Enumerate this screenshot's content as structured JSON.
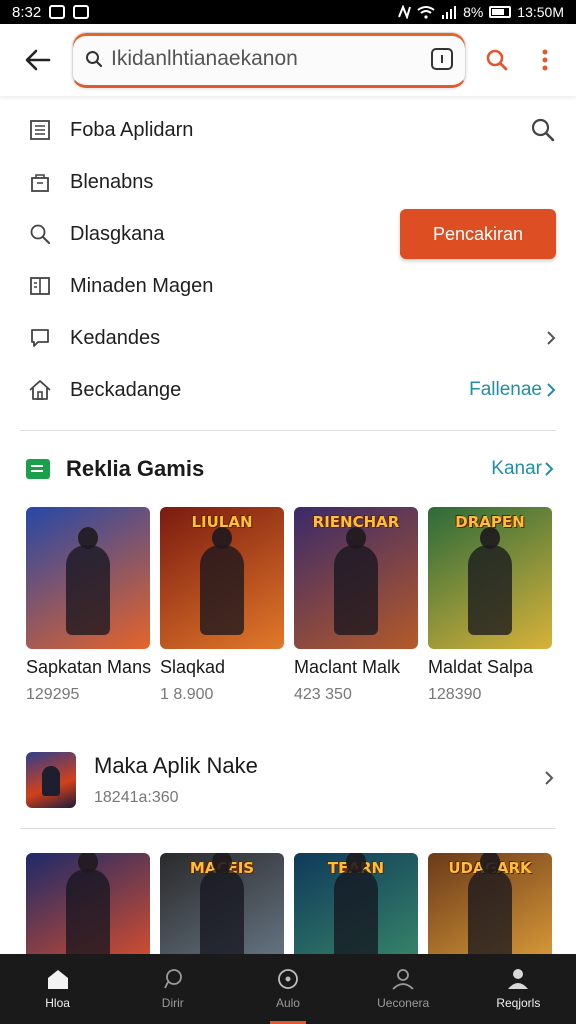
{
  "status_bar": {
    "time_left": "8:32",
    "battery": "8%",
    "time_right": "13:50M"
  },
  "search": {
    "value": "Ikidanlhtianaekanon"
  },
  "menu": [
    {
      "label": "Foba Aplidarn",
      "icon": "grid-icon"
    },
    {
      "label": "Blenabns",
      "icon": "bag-icon"
    },
    {
      "label": "Dlasgkana",
      "icon": "search-icon"
    },
    {
      "label": "Minaden Magen",
      "icon": "book-icon"
    },
    {
      "label": "Kedandes",
      "icon": "chat-icon"
    },
    {
      "label": "Beckadange",
      "icon": "home-icon"
    }
  ],
  "menu_actions": {
    "search_button": "Pencakiran",
    "link": "Fallenae"
  },
  "games_section": {
    "title": "Reklia Gamis",
    "link": "Kanar"
  },
  "games": [
    {
      "name": "Sapkatan Mans",
      "count": "129295",
      "poster": "",
      "colors": [
        "#2548a8",
        "#e6642a"
      ]
    },
    {
      "name": "Slaqkad",
      "count": "1 8.900",
      "poster": "LIULAN",
      "colors": [
        "#7a1a10",
        "#e2792a"
      ]
    },
    {
      "name": "Maclant Malk",
      "count": "423 350",
      "poster": "RIENCHAR",
      "colors": [
        "#3a2a6a",
        "#b55a2a"
      ]
    },
    {
      "name": "Maldat Salpa",
      "count": "128390",
      "poster": "DRAPEN",
      "colors": [
        "#2b6a3a",
        "#d8b23a"
      ]
    }
  ],
  "app": {
    "title": "Maka Aplik Nake",
    "subtitle": "18241a:360"
  },
  "games2": [
    {
      "poster": "",
      "colors": [
        "#1c2a6a",
        "#e0502a"
      ]
    },
    {
      "poster": "MACEIS",
      "colors": [
        "#2a2a2a",
        "#6a7a8a"
      ]
    },
    {
      "poster": "TEARN",
      "colors": [
        "#0f3a5a",
        "#3a8a6a"
      ]
    },
    {
      "poster": "UDAGARK",
      "colors": [
        "#6a3a1a",
        "#e0a03a"
      ]
    }
  ],
  "bottom_nav": [
    {
      "label": "Hloa",
      "icon": "home-icon"
    },
    {
      "label": "Dirir",
      "icon": "chat-icon"
    },
    {
      "label": "Aulo",
      "icon": "compass-icon"
    },
    {
      "label": "Ueconera",
      "icon": "user-icon"
    },
    {
      "label": "Reqjorls",
      "icon": "profile-icon"
    }
  ],
  "colors": {
    "accent": "#dd4f22",
    "teal": "#1f8fa3",
    "green": "#1aa04a"
  }
}
